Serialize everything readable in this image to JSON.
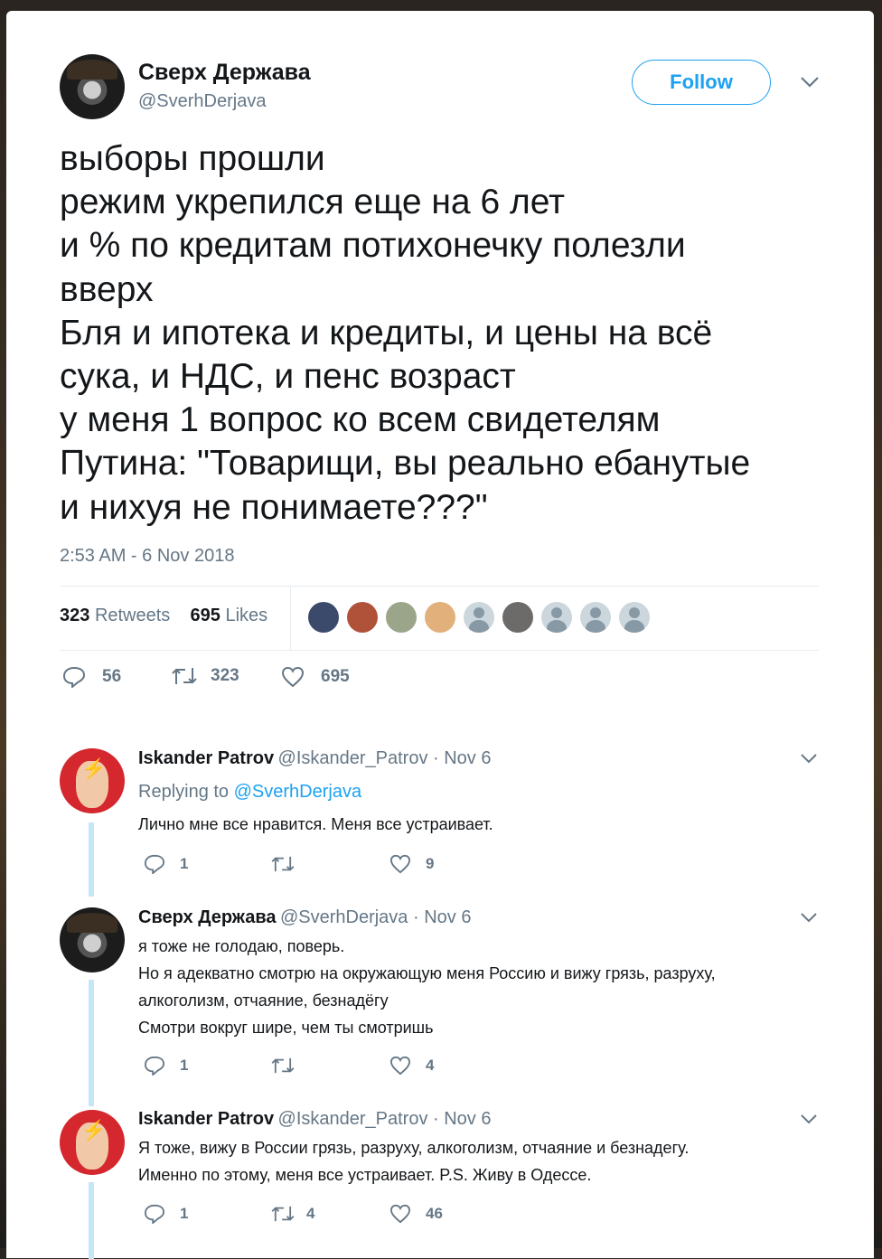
{
  "tweet": {
    "author_name": "Сверх Держава",
    "author_handle": "@SverhDerjava",
    "follow_label": "Follow",
    "text_lines": [
      "выборы прошли",
      "режим укрепился еще на 6 лет",
      "и % по кредитам потихонечку полезли",
      "вверх",
      "Бля и ипотека и кредиты, и цены на всё",
      "сука, и НДС, и пенс возраст",
      "у меня 1 вопрос ко всем свидетелям",
      "Путина: \"Товарищи, вы реально ебанутые",
      "и нихуя не понимаете???\""
    ],
    "timestamp": "2:53 AM - 6 Nov 2018",
    "retweets_count": "323",
    "retweets_label": "Retweets",
    "likes_count": "695",
    "likes_label": "Likes",
    "actions": {
      "replies": "56",
      "retweets": "323",
      "likes": "695"
    }
  },
  "replies": [
    {
      "name": "Iskander Patrov",
      "meta": "@Iskander_Patrov · Nov 6",
      "replying_prefix": "Replying to",
      "replying_to": "@SverhDerjava",
      "lines": [
        "Лично мне все нравится. Меня все устраивает."
      ],
      "replies": "1",
      "retweets": "",
      "likes": "9"
    },
    {
      "name": "Сверх Держава",
      "meta": "@SverhDerjava · Nov 6",
      "lines": [
        "я тоже не голодаю, поверь.",
        "Но я адекватно смотрю на окружающую меня Россию и вижу грязь, разруху,",
        "алкоголизм, отчаяние, безнадёгу",
        "Смотри вокруг шире, чем ты смотришь"
      ],
      "replies": "1",
      "retweets": "",
      "likes": "4"
    },
    {
      "name": "Iskander Patrov",
      "meta": "@Iskander_Patrov · Nov 6",
      "lines": [
        "Я тоже, вижу в России грязь, разруху, алкоголизм, отчаяние и безнадегу.",
        "Именно по этому, меня все устраивает.  P.S.  Живу в Одессе."
      ],
      "replies": "1",
      "retweets": "4",
      "likes": "46"
    }
  ],
  "colors": {
    "accent": "#1da1f2",
    "text": "#14171a",
    "muted": "#657786",
    "thread": "#c4e6f8"
  },
  "icons": [
    "chevron-down-icon",
    "reply-icon",
    "retweet-icon",
    "heart-icon"
  ]
}
